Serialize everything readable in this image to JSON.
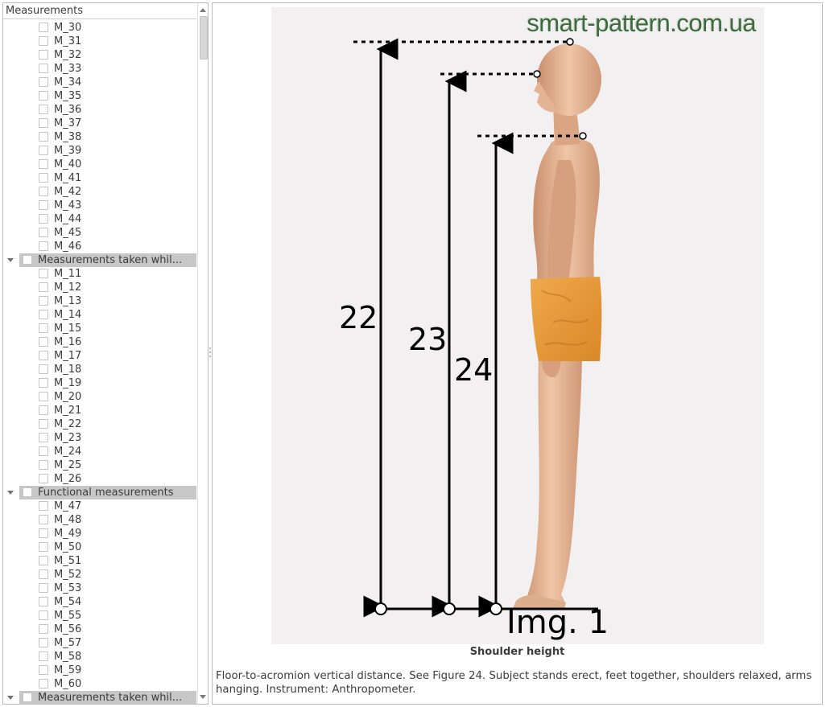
{
  "tree": {
    "header": "Measurements",
    "rows": [
      {
        "kind": "item",
        "label": "M_30"
      },
      {
        "kind": "item",
        "label": "M_31"
      },
      {
        "kind": "item",
        "label": "M_32"
      },
      {
        "kind": "item",
        "label": "M_33"
      },
      {
        "kind": "item",
        "label": "M_34"
      },
      {
        "kind": "item",
        "label": "M_35"
      },
      {
        "kind": "item",
        "label": "M_36"
      },
      {
        "kind": "item",
        "label": "M_37"
      },
      {
        "kind": "item",
        "label": "M_38"
      },
      {
        "kind": "item",
        "label": "M_39"
      },
      {
        "kind": "item",
        "label": "M_40"
      },
      {
        "kind": "item",
        "label": "M_41"
      },
      {
        "kind": "item",
        "label": "M_42"
      },
      {
        "kind": "item",
        "label": "M_43"
      },
      {
        "kind": "item",
        "label": "M_44"
      },
      {
        "kind": "item",
        "label": "M_45"
      },
      {
        "kind": "item",
        "label": "M_46"
      },
      {
        "kind": "group",
        "label": "Measurements taken whil..."
      },
      {
        "kind": "item",
        "label": "M_11"
      },
      {
        "kind": "item",
        "label": "M_12"
      },
      {
        "kind": "item",
        "label": "M_13"
      },
      {
        "kind": "item",
        "label": "M_14"
      },
      {
        "kind": "item",
        "label": "M_15"
      },
      {
        "kind": "item",
        "label": "M_16"
      },
      {
        "kind": "item",
        "label": "M_17"
      },
      {
        "kind": "item",
        "label": "M_18"
      },
      {
        "kind": "item",
        "label": "M_19"
      },
      {
        "kind": "item",
        "label": "M_20"
      },
      {
        "kind": "item",
        "label": "M_21"
      },
      {
        "kind": "item",
        "label": "M_22"
      },
      {
        "kind": "item",
        "label": "M_23"
      },
      {
        "kind": "item",
        "label": "M_24"
      },
      {
        "kind": "item",
        "label": "M_25"
      },
      {
        "kind": "item",
        "label": "M_26"
      },
      {
        "kind": "group",
        "label": "Functional measurements"
      },
      {
        "kind": "item",
        "label": "M_47"
      },
      {
        "kind": "item",
        "label": "M_48"
      },
      {
        "kind": "item",
        "label": "M_49"
      },
      {
        "kind": "item",
        "label": "M_50"
      },
      {
        "kind": "item",
        "label": "M_51"
      },
      {
        "kind": "item",
        "label": "M_52"
      },
      {
        "kind": "item",
        "label": "M_53"
      },
      {
        "kind": "item",
        "label": "M_54"
      },
      {
        "kind": "item",
        "label": "M_55"
      },
      {
        "kind": "item",
        "label": "M_56"
      },
      {
        "kind": "item",
        "label": "M_57"
      },
      {
        "kind": "item",
        "label": "M_58"
      },
      {
        "kind": "item",
        "label": "M_59"
      },
      {
        "kind": "item",
        "label": "M_60"
      },
      {
        "kind": "group",
        "label": "Measurements taken whil..."
      }
    ]
  },
  "figure": {
    "watermark": "smart-pattern.com.ua",
    "labels": [
      "22",
      "23",
      "24"
    ],
    "image_label": "Img. 1",
    "title": "Shoulder height",
    "description": "Floor-to-acromion vertical distance. See Figure 24. Subject stands erect, feet together, shoulders relaxed, arms hanging. Instrument: Anthropometer.",
    "colors": {
      "background": "#f2f0f1",
      "skin": "#e2b392",
      "shorts": "#e89a3c",
      "lines": "#000000"
    }
  },
  "icons": {
    "expand": "chevron-down-icon",
    "checkbox": "checkbox-icon",
    "scroll_up": "scroll-up-arrow-icon",
    "scroll_down": "scroll-down-arrow-icon"
  }
}
